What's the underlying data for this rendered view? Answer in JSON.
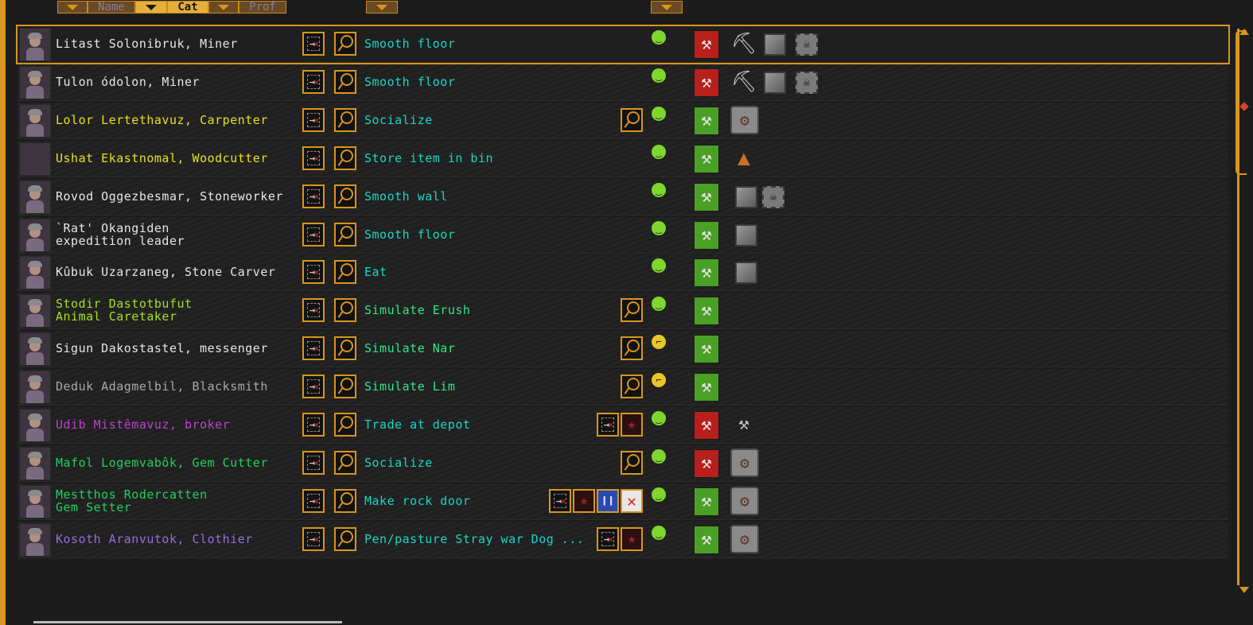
{
  "header": {
    "sort_name": "Name",
    "sort_cat": "Cat",
    "sort_prof": "Prof"
  },
  "colors": {
    "accent": "#d8961c",
    "job_text": "#19d6c6",
    "simulate_text": "#2de88a",
    "labor_red": "#b8201c",
    "labor_green": "#4aa024"
  },
  "units": [
    {
      "name": "Litast Solonibruk, Miner",
      "color": "#e6e6e6",
      "job": "Smooth floor",
      "labor": "red",
      "mood": "content",
      "equipment": [
        "pick-icon",
        "stone-block-icon",
        "skull-icon"
      ],
      "selected": true
    },
    {
      "name": "Tulon ódolon, Miner",
      "color": "#e6e6e6",
      "job": "Smooth floor",
      "labor": "red",
      "mood": "content",
      "equipment": [
        "pick-icon",
        "stone-block-icon",
        "skull-icon"
      ]
    },
    {
      "name": "Lolor Lertethavuz, Carpenter",
      "color": "#e8e020",
      "job": "Socialize",
      "labor": "green",
      "mood": "content",
      "extra": [
        "magnifier-icon"
      ],
      "equipment": [
        "carpenter-workshop-icon"
      ]
    },
    {
      "name": "Ushat Ekastnomal, Woodcutter",
      "color": "#e8e020",
      "job": "Store item in bin",
      "labor": "green",
      "mood": "content",
      "equipment": [
        "axe-stump-icon"
      ],
      "no_portrait": true
    },
    {
      "name": "Rovod Oggezbesmar, Stoneworker",
      "color": "#e6e6e6",
      "job": "Smooth wall",
      "labor": "green",
      "mood": "content",
      "equipment": [
        "stone-block-icon",
        "skull-icon"
      ]
    },
    {
      "name": "`Rat' Okangiden\nexpedition leader",
      "color": "#e6e6e6",
      "job": "Smooth floor",
      "labor": "green",
      "mood": "content",
      "equipment": [
        "stone-block-icon"
      ]
    },
    {
      "name": "Kûbuk Uzarzaneg, Stone Carver",
      "color": "#e6e6e6",
      "job": "Eat",
      "labor": "green",
      "mood": "content",
      "equipment": [
        "stone-block-icon"
      ]
    },
    {
      "name": "Stodir Dastotbufut\nAnimal Caretaker",
      "color": "#a8e020",
      "job": "Simulate Erush",
      "labor": "green",
      "mood": "content",
      "extra": [
        "magnifier-icon"
      ],
      "equipment": []
    },
    {
      "name": "Sigun Dakostastel, messenger",
      "color": "#e6e6e6",
      "job": "Simulate Nar",
      "labor": "green",
      "mood": "meh",
      "extra": [
        "magnifier-icon"
      ],
      "equipment": []
    },
    {
      "name": "Deduk Adagmelbil, Blacksmith",
      "color": "#a8a8a8",
      "job": "Simulate Lim",
      "labor": "green",
      "mood": "meh",
      "extra": [
        "magnifier-icon"
      ],
      "equipment": []
    },
    {
      "name": "Udib Mistêmavuz, broker",
      "color": "#c040d0",
      "job": "Trade at depot",
      "labor": "red",
      "mood": "content",
      "extra": [
        "remove-icon",
        "body-icon"
      ],
      "equipment": [
        "anvil-icon"
      ]
    },
    {
      "name": "Mafol Logemvabôk, Gem Cutter",
      "color": "#20d060",
      "job": "Socialize",
      "labor": "red",
      "mood": "content",
      "extra": [
        "magnifier-icon"
      ],
      "equipment": [
        "gem-workshop-icon"
      ]
    },
    {
      "name": "Mestthos Rodercatten\nGem Setter",
      "color": "#20d060",
      "job": "Make rock door",
      "labor": "green",
      "mood": "content",
      "extra": [
        "remove-icon",
        "body-icon",
        "pause-icon",
        "cancel-icon"
      ],
      "equipment": [
        "jeweler-workshop-icon"
      ]
    },
    {
      "name": "Kosoth Aranvutok, Clothier",
      "color": "#9a6ae0",
      "job": "Pen/pasture Stray war Dog ...",
      "labor": "green",
      "mood": "content",
      "extra": [
        "remove-icon",
        "body-icon"
      ],
      "equipment": [
        "clothier-workshop-icon"
      ]
    }
  ]
}
